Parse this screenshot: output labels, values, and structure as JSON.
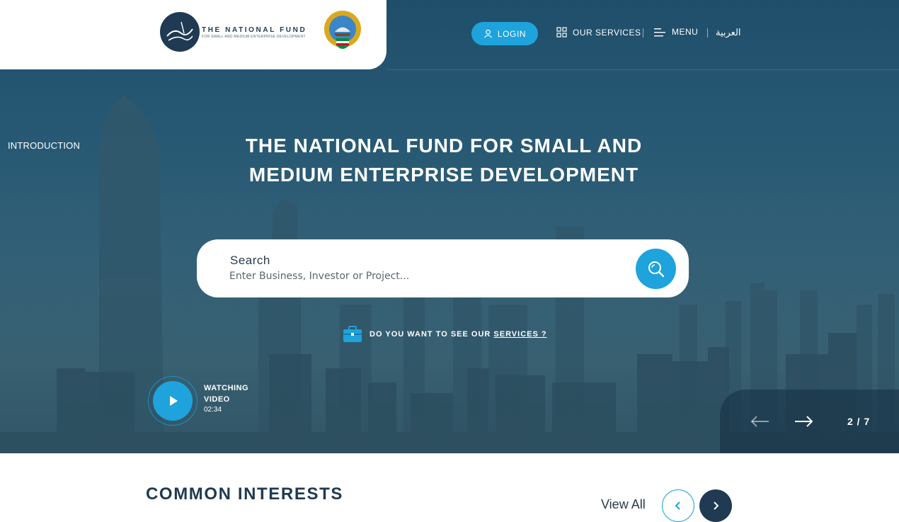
{
  "header": {
    "logo_title": "THE NATIONAL FUND",
    "logo_subtitle": "FOR SMALL AND MEDIUM ENTERPRISE DEVELOPMENT",
    "login_label": "LOGIN",
    "services_label": "OUR SERVICES",
    "menu_label": "MENU",
    "language_label": "العربية"
  },
  "hero": {
    "side_label": "INTRODUCTION",
    "title": "THE NATIONAL FUND FOR SMALL AND MEDIUM ENTERPRISE DEVELOPMENT",
    "search": {
      "label": "Search",
      "placeholder": "Enter Business, Investor or Project..."
    },
    "services_prompt": "DO YOU WANT TO SEE OUR ",
    "services_link": "SERVICES ?",
    "video": {
      "label": "WATCHING VIDEO",
      "duration": "02:34"
    },
    "slider": {
      "counter": "2 / 7"
    }
  },
  "common_interests": {
    "title": "COMMON INTERESTS",
    "view_all": "View All"
  },
  "colors": {
    "accent": "#1ea3dc",
    "dark": "#1f3a52"
  },
  "icons": [
    "user-icon",
    "grid-icon",
    "menu-icon",
    "search-icon",
    "briefcase-icon",
    "play-icon",
    "arrow-left-icon",
    "arrow-right-icon",
    "chevron-left-icon",
    "chevron-right-icon"
  ]
}
